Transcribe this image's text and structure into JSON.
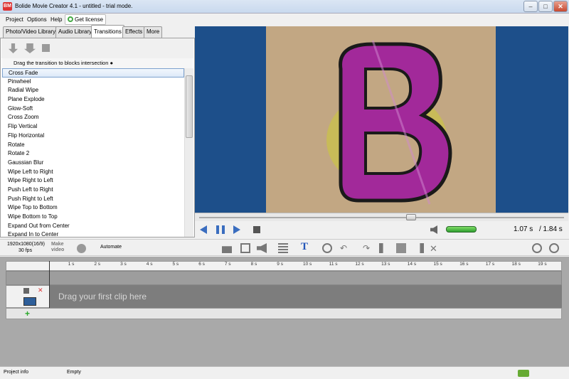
{
  "window": {
    "title": "Bolide Movie Creator 4.1 - untitled  - trial mode.",
    "app_icon": "BM"
  },
  "menu": {
    "items": [
      "Project",
      "Options",
      "Help"
    ],
    "license_label": "Get license"
  },
  "tabs": [
    "Photo/Video Library",
    "Audio Library",
    "Transitions",
    "Effects",
    "More"
  ],
  "hint": "Drag the transition to blocks intersection",
  "transitions": [
    "Cross Fade",
    "Pinwheel",
    "Radial Wipe",
    "Plane Explode",
    "Glow-Soft",
    "Cross Zoom",
    "Flip Vertical",
    "Flip Horizontal",
    "Rotate",
    "Rotate 2",
    "Gaussian Blur",
    "Wipe Left to Right",
    "Wipe Right to Left",
    "Push Left to Right",
    "Push Right to Left",
    "Wipe Top to Bottom",
    "Wipe Bottom to Top",
    "Expand Out from Center",
    "Expand In to Center"
  ],
  "selected_transition": "Cross Fade",
  "preview": {
    "letter": "B",
    "bg_color": "#1d4f8a",
    "canvas_color": "#c2a783",
    "seek_fraction": 0.58,
    "volume_fraction": 1.0
  },
  "playback": {
    "current": "1.07 s",
    "total": "/ 1.84 s"
  },
  "bottom_toolbar": {
    "resolution": "1920x1080(16/9)",
    "fps": "30 fps",
    "make_video": "Make video",
    "automate": "Automate"
  },
  "ruler_ticks": [
    "1 s",
    "2 s",
    "3 s",
    "4 s",
    "5 s",
    "6 s",
    "7 s",
    "8 s",
    "9 s",
    "10 s",
    "11 s",
    "12 s",
    "13 s",
    "14 s",
    "15 s",
    "16 s",
    "17 s",
    "18 s",
    "19 s"
  ],
  "timeline": {
    "drag_hint": "Drag your first clip here"
  },
  "status": {
    "project_info": "Project info",
    "state": "Empty"
  }
}
